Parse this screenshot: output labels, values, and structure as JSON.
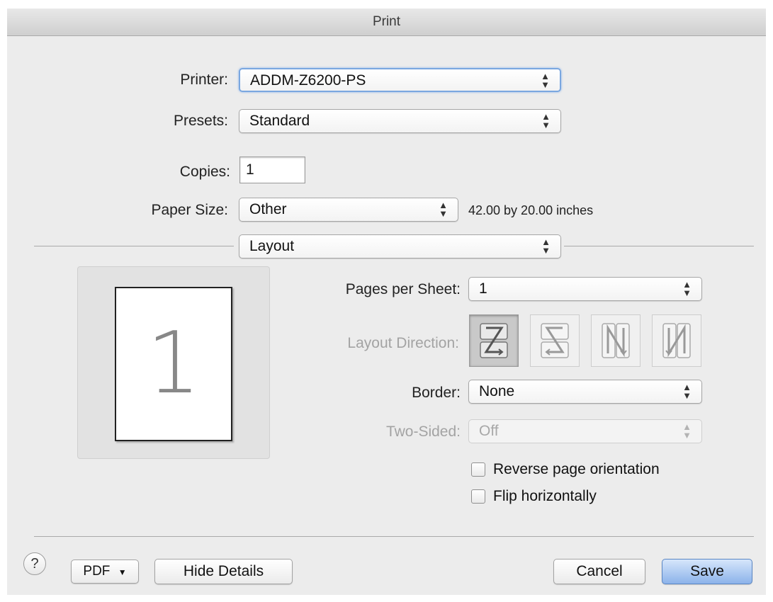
{
  "window": {
    "title": "Print"
  },
  "printer": {
    "label": "Printer:",
    "value": "ADDM-Z6200-PS"
  },
  "presets": {
    "label": "Presets:",
    "value": "Standard"
  },
  "copies": {
    "label": "Copies:",
    "value": "1"
  },
  "paper_size": {
    "label": "Paper Size:",
    "value": "Other",
    "dimensions": "42.00 by 20.00 inches"
  },
  "section": {
    "value": "Layout"
  },
  "preview": {
    "page_number": "1"
  },
  "layout": {
    "pages_per_sheet": {
      "label": "Pages per Sheet:",
      "value": "1"
    },
    "layout_direction": {
      "label": "Layout Direction:",
      "options": [
        "z-right-down",
        "s-left-down",
        "n-down-right",
        "n-down-left"
      ],
      "selected": 0
    },
    "border": {
      "label": "Border:",
      "value": "None"
    },
    "two_sided": {
      "label": "Two-Sided:",
      "value": "Off"
    },
    "reverse_orientation": {
      "label": "Reverse page orientation",
      "checked": false
    },
    "flip_horizontally": {
      "label": "Flip horizontally",
      "checked": false
    }
  },
  "footer": {
    "help": "?",
    "pdf": "PDF",
    "hide_details": "Hide Details",
    "cancel": "Cancel",
    "save": "Save"
  },
  "colors": {
    "accent": "#8cb3ea",
    "window_bg": "#ececec"
  }
}
